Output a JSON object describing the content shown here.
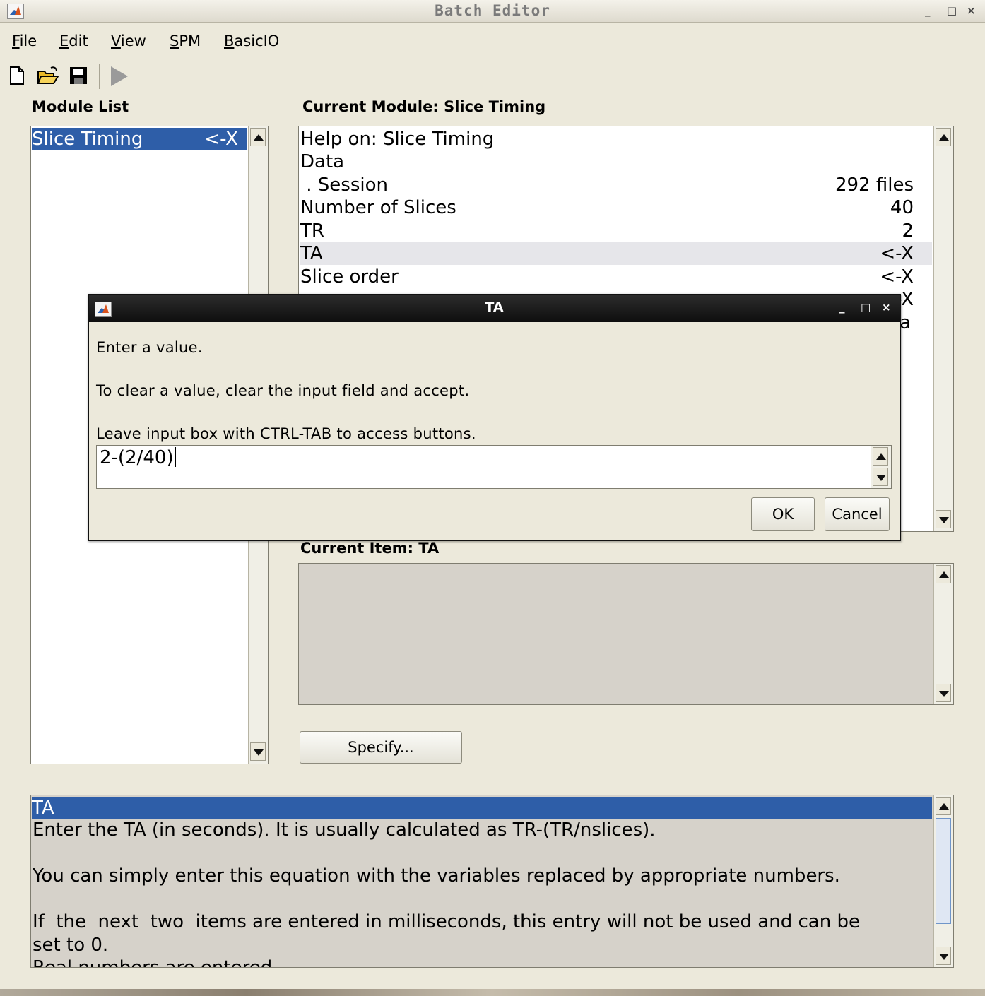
{
  "window": {
    "title": "Batch Editor",
    "controls": [
      "_",
      "□",
      "×"
    ]
  },
  "menu": {
    "items": [
      "File",
      "Edit",
      "View",
      "SPM",
      "BasicIO"
    ]
  },
  "toolbar": {
    "icons": [
      "new-file-icon",
      "open-folder-icon",
      "save-icon",
      "run-icon"
    ]
  },
  "module_list": {
    "heading": "Module List",
    "items": [
      {
        "label": "Slice Timing",
        "flag": "<-X",
        "selected": true
      }
    ]
  },
  "current_module": {
    "heading": "Current Module: Slice Timing",
    "rows": [
      {
        "label": "Help on: Slice Timing",
        "value": ""
      },
      {
        "label": "Data",
        "value": ""
      },
      {
        "label": " . Session",
        "value": "292 files"
      },
      {
        "label": "Number of Slices",
        "value": "40"
      },
      {
        "label": "TR",
        "value": "2"
      },
      {
        "label": "TA",
        "value": "<-X",
        "highlighted": true
      },
      {
        "label": "Slice order",
        "value": "<-X"
      }
    ],
    "partial_values": [
      "-X",
      "a"
    ]
  },
  "current_item": {
    "heading": "Current Item: TA"
  },
  "specify_button": "Specify...",
  "help_panel": {
    "title": "TA",
    "lines": [
      "Enter the TA (in seconds). It is usually calculated as TR-(TR/nslices).",
      "",
      "You can simply enter this equation with the variables replaced by appropriate numbers.",
      "",
      "If  the  next  two  items are entered in milliseconds, this entry will not be used and can be",
      "set to 0.",
      "Real numbers are entered."
    ]
  },
  "dialog": {
    "title": "TA",
    "controls": [
      "_",
      "□",
      "×"
    ],
    "messages": [
      "Enter a value.",
      "To clear a value, clear the input field and accept.",
      "Leave input box with CTRL-TAB to access buttons."
    ],
    "input_value": "2-(2/40)",
    "ok_label": "OK",
    "cancel_label": "Cancel"
  },
  "colors": {
    "selection": "#2e5ea8",
    "highlight_row": "#e6e6ea",
    "window_bg": "#ece9db",
    "panel_gray": "#d6d2ca"
  }
}
